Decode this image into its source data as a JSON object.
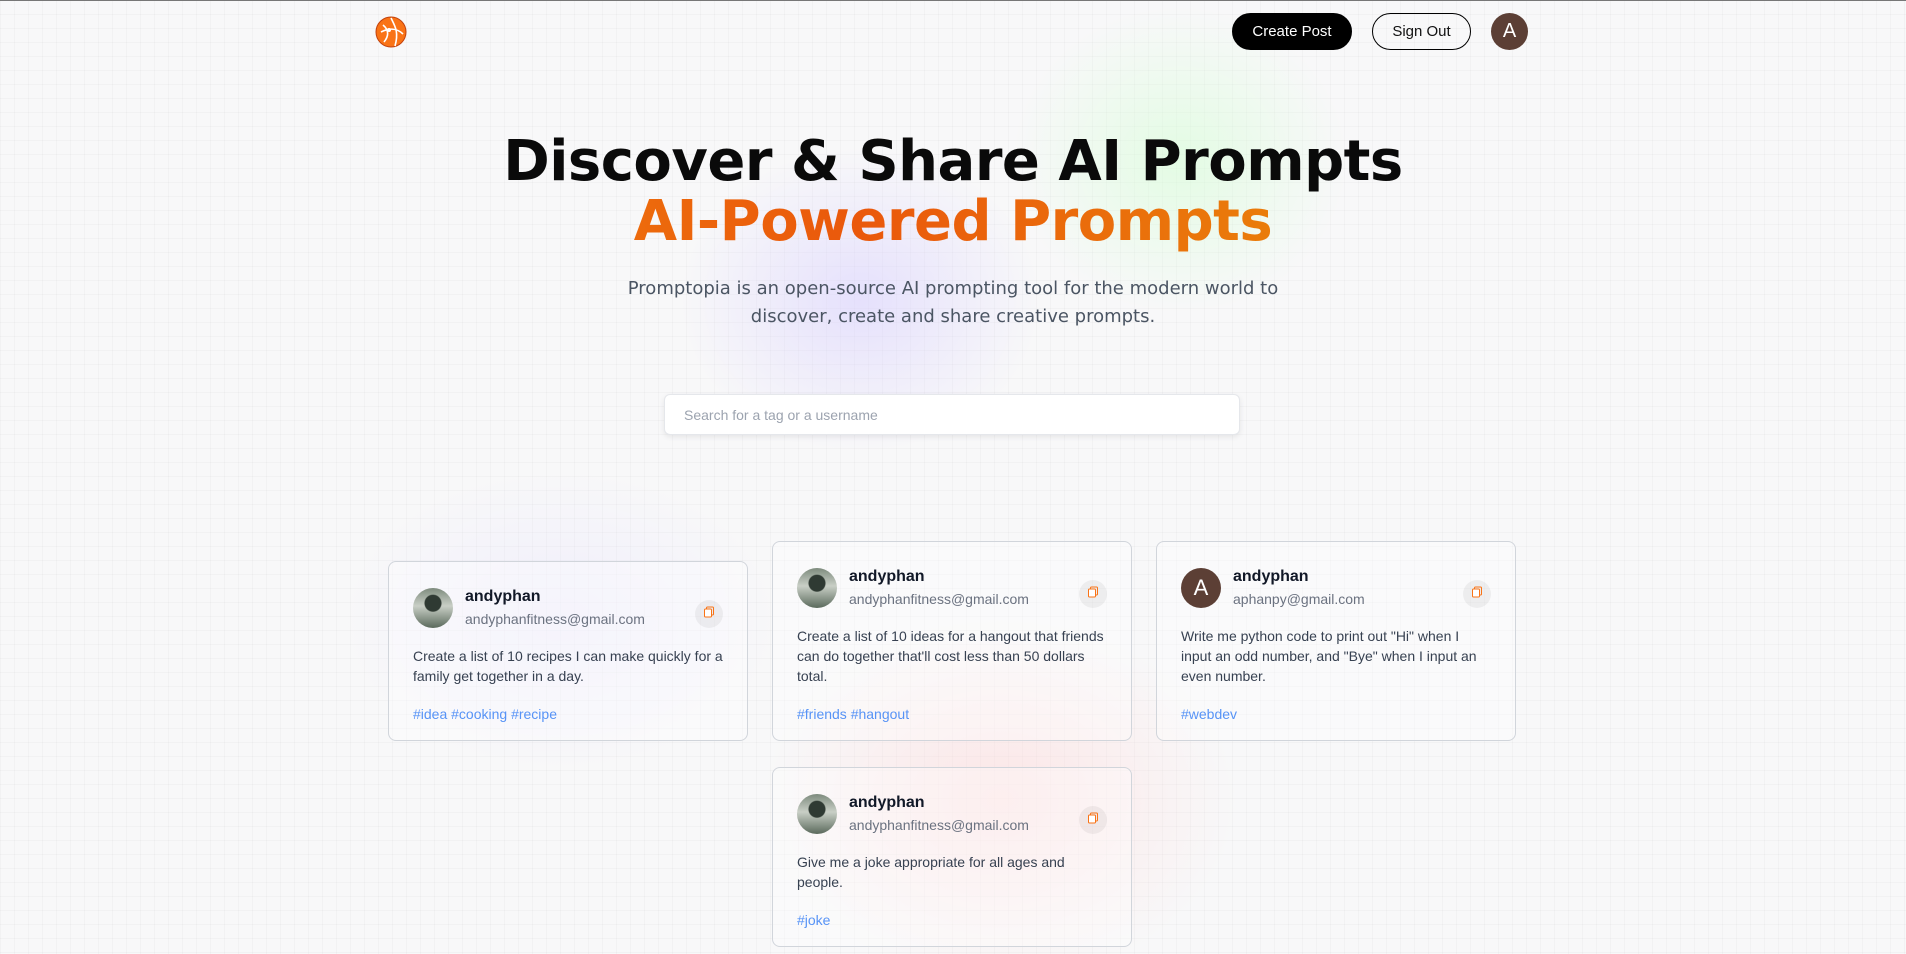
{
  "nav": {
    "create_label": "Create Post",
    "signout_label": "Sign Out",
    "avatar_letter": "A"
  },
  "hero": {
    "title_line1": "Discover & Share AI Prompts",
    "title_line2": "AI-Powered Prompts",
    "description": "Promptopia is an open-source AI prompting tool for the modern world to discover, create and share creative prompts."
  },
  "search": {
    "placeholder": "Search for a tag or a username",
    "value": ""
  },
  "colors": {
    "brand_orange": "#f97316",
    "accent_gradient": [
      "#f59e0b",
      "#ea580c",
      "#eab308"
    ],
    "tag_blue": "#3b82f6",
    "avatar_brown": "#5c3f35"
  },
  "posts": [
    {
      "username": "andyphan",
      "email": "andyphanfitness@gmail.com",
      "avatar": "photo",
      "prompt": "Create a list of 10 recipes I can make quickly for a family get together in a day.",
      "tags": "#idea #cooking #recipe",
      "copy_icon": "copy-icon"
    },
    {
      "username": "andyphan",
      "email": "andyphanfitness@gmail.com",
      "avatar": "photo",
      "prompt": "Create a list of 10 ideas for a hangout that friends can do together that'll cost less than 50 dollars total.",
      "tags": "#friends #hangout",
      "copy_icon": "copy-icon"
    },
    {
      "username": "andyphan",
      "email": "aphanpy@gmail.com",
      "avatar": "letter",
      "avatar_letter": "A",
      "prompt": "Write me python code to print out \"Hi\" when I input an odd number, and \"Bye\" when I input an even number.",
      "tags": "#webdev",
      "copy_icon": "copy-icon"
    },
    {
      "username": "andyphan",
      "email": "andyphanfitness@gmail.com",
      "avatar": "photo",
      "prompt": "Give me a joke appropriate for all ages and people.",
      "tags": "#joke",
      "copy_icon": "copy-icon"
    }
  ]
}
